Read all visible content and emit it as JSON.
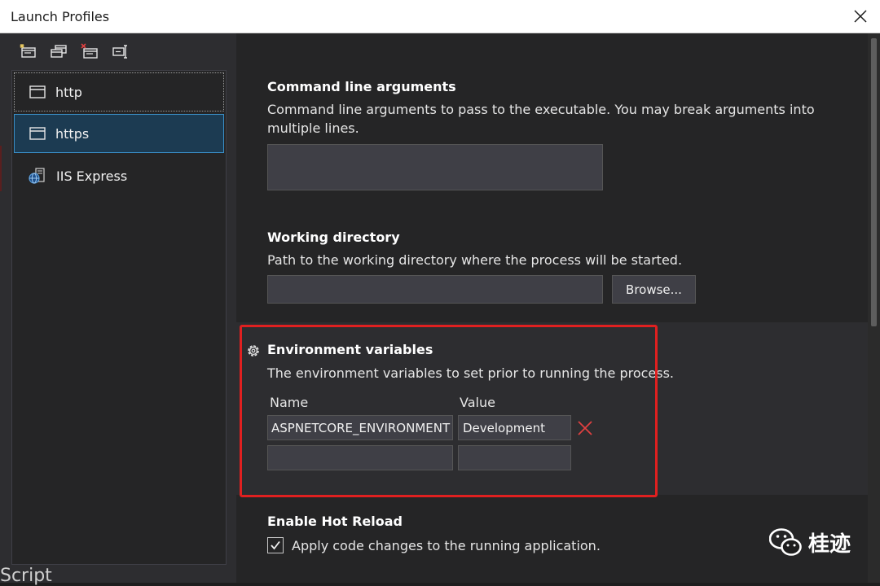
{
  "window": {
    "title": "Launch Profiles"
  },
  "toolbar": {
    "icons": [
      "new-profile-icon",
      "duplicate-profile-icon",
      "delete-profile-icon",
      "rename-profile-icon"
    ]
  },
  "profiles": {
    "items": [
      {
        "label": "http",
        "icon": "window-icon",
        "state": "focused"
      },
      {
        "label": "https",
        "icon": "window-icon",
        "state": "selected"
      },
      {
        "label": "IIS Express",
        "icon": "iis-globe-icon",
        "state": "normal"
      }
    ]
  },
  "command_line": {
    "title": "Command line arguments",
    "description": "Command line arguments to pass to the executable. You may break arguments into multiple lines.",
    "value": ""
  },
  "working_directory": {
    "title": "Working directory",
    "description": "Path to the working directory where the process will be started.",
    "value": "",
    "browse_label": "Browse..."
  },
  "env_vars": {
    "title": "Environment variables",
    "description": "The environment variables to set prior to running the process.",
    "name_header": "Name",
    "value_header": "Value",
    "rows": [
      {
        "name": "ASPNETCORE_ENVIRONMENT",
        "value": "Development"
      },
      {
        "name": "",
        "value": ""
      }
    ]
  },
  "hot_reload": {
    "title": "Enable Hot Reload",
    "checkbox_label": "Apply code changes to the running application.",
    "checked": true
  },
  "watermark": {
    "text": "桂迹"
  },
  "background_fragment": {
    "text": "Script"
  },
  "colors": {
    "highlight": "#e02020",
    "selection": "#1c3b52",
    "accent": "#3a8fc8",
    "delete": "#e04040"
  }
}
